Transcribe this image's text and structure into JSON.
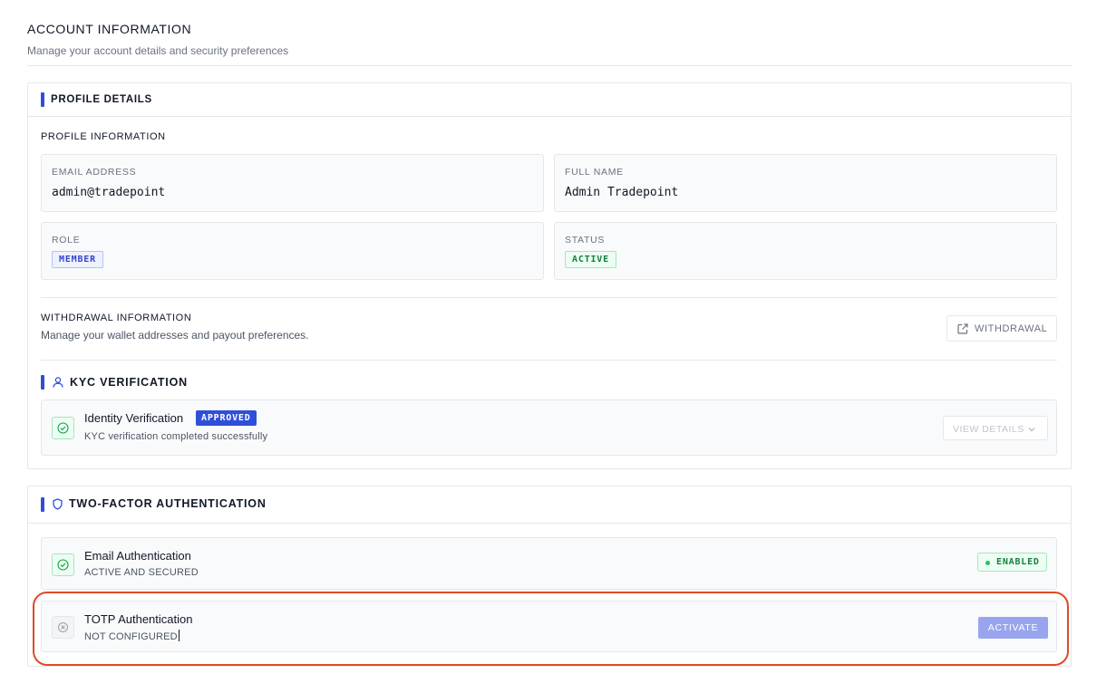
{
  "page": {
    "title": "ACCOUNT INFORMATION",
    "subtitle": "Manage your account details and security preferences"
  },
  "profile": {
    "section_title": "PROFILE DETAILS",
    "info_heading": "PROFILE INFORMATION",
    "fields": {
      "email": {
        "label": "EMAIL ADDRESS",
        "value": "admin@tradepoint"
      },
      "full_name": {
        "label": "FULL NAME",
        "value": "Admin Tradepoint"
      },
      "role": {
        "label": "ROLE",
        "value": "MEMBER"
      },
      "status": {
        "label": "STATUS",
        "value": "ACTIVE"
      }
    },
    "withdrawal": {
      "heading": "WITHDRAWAL INFORMATION",
      "description": "Manage your wallet addresses and payout preferences.",
      "button_label": "WITHDRAWAL",
      "button_icon": "external-link-icon"
    }
  },
  "kyc": {
    "section_title": "KYC VERIFICATION",
    "section_icon": "user-icon",
    "item": {
      "title": "Identity Verification",
      "badge": "APPROVED",
      "subtitle": "KYC verification completed successfully",
      "icon": "check-circle-icon",
      "button_label": "VIEW DETAILS",
      "button_icon": "chevron-down-icon"
    }
  },
  "two_factor": {
    "section_title": "TWO-FACTOR AUTHENTICATION",
    "section_icon": "shield-icon",
    "items": [
      {
        "title": "Email Authentication",
        "subtitle": "ACTIVE AND SECURED",
        "icon": "check-circle-icon",
        "status_badge": "ENABLED"
      },
      {
        "title": "TOTP Authentication",
        "subtitle": "NOT CONFIGURED",
        "icon": "x-circle-icon",
        "button_label": "ACTIVATE"
      }
    ]
  },
  "colors": {
    "accent": "#2f4fd8",
    "success": "#15803d",
    "activate_button": "#98a5ee",
    "highlight_ring": "#e04a24"
  }
}
